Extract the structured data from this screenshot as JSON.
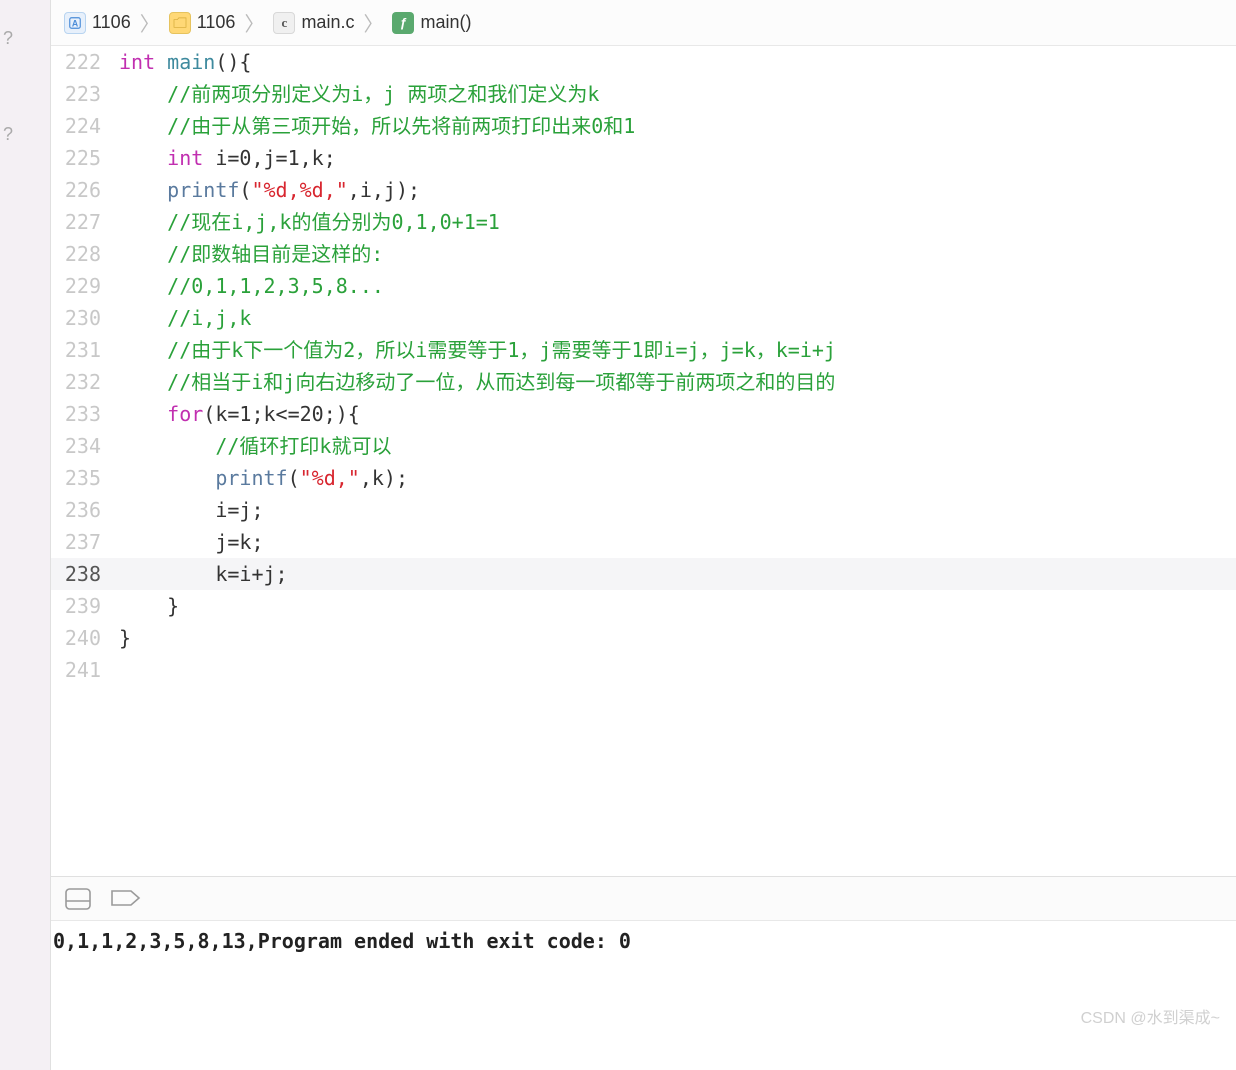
{
  "breadcrumb": [
    {
      "icon": "project",
      "label": "1106"
    },
    {
      "icon": "folder",
      "label": "1106"
    },
    {
      "icon": "cfile",
      "label": "main.c"
    },
    {
      "icon": "func",
      "label": "main()"
    }
  ],
  "current_line": 238,
  "lines": [
    {
      "n": 222,
      "tokens": [
        [
          "kw",
          "int "
        ],
        [
          "func",
          "main"
        ],
        [
          "plain",
          "(){"
        ]
      ]
    },
    {
      "n": 223,
      "tokens": [
        [
          "plain",
          "    "
        ],
        [
          "cmt",
          "//前两项分别定义为i，j 两项之和我们定义为k"
        ]
      ]
    },
    {
      "n": 224,
      "tokens": [
        [
          "plain",
          "    "
        ],
        [
          "cmt",
          "//由于从第三项开始，所以先将前两项打印出来0和1"
        ]
      ]
    },
    {
      "n": 225,
      "tokens": [
        [
          "plain",
          "    "
        ],
        [
          "kw",
          "int"
        ],
        [
          "plain",
          " i=0,j=1,k;"
        ]
      ]
    },
    {
      "n": 226,
      "tokens": [
        [
          "plain",
          "    "
        ],
        [
          "call",
          "printf"
        ],
        [
          "plain",
          "("
        ],
        [
          "str",
          "\"%d,%d,\""
        ],
        [
          "plain",
          ",i,j);"
        ]
      ]
    },
    {
      "n": 227,
      "tokens": [
        [
          "plain",
          "    "
        ],
        [
          "cmt",
          "//现在i,j,k的值分别为0,1,0+1=1"
        ]
      ]
    },
    {
      "n": 228,
      "tokens": [
        [
          "plain",
          "    "
        ],
        [
          "cmt",
          "//即数轴目前是这样的:"
        ]
      ]
    },
    {
      "n": 229,
      "tokens": [
        [
          "plain",
          "    "
        ],
        [
          "cmt",
          "//0,1,1,2,3,5,8..."
        ]
      ]
    },
    {
      "n": 230,
      "tokens": [
        [
          "plain",
          "    "
        ],
        [
          "cmt",
          "//i,j,k"
        ]
      ]
    },
    {
      "n": 231,
      "tokens": [
        [
          "plain",
          "    "
        ],
        [
          "cmt",
          "//由于k下一个值为2，所以i需要等于1，j需要等于1即i=j，j=k，k=i+j"
        ]
      ]
    },
    {
      "n": 232,
      "tokens": [
        [
          "plain",
          "    "
        ],
        [
          "cmt",
          "//相当于i和j向右边移动了一位，从而达到每一项都等于前两项之和的目的"
        ]
      ]
    },
    {
      "n": 233,
      "tokens": [
        [
          "plain",
          "    "
        ],
        [
          "kw",
          "for"
        ],
        [
          "plain",
          "(k=1;k<=20;){"
        ]
      ]
    },
    {
      "n": 234,
      "tokens": [
        [
          "plain",
          "        "
        ],
        [
          "cmt",
          "//循环打印k就可以"
        ]
      ]
    },
    {
      "n": 235,
      "tokens": [
        [
          "plain",
          "        "
        ],
        [
          "call",
          "printf"
        ],
        [
          "plain",
          "("
        ],
        [
          "str",
          "\"%d,\""
        ],
        [
          "plain",
          ",k);"
        ]
      ]
    },
    {
      "n": 236,
      "tokens": [
        [
          "plain",
          "        i=j;"
        ]
      ]
    },
    {
      "n": 237,
      "tokens": [
        [
          "plain",
          "        j=k;"
        ]
      ]
    },
    {
      "n": 238,
      "tokens": [
        [
          "plain",
          "        k=i+j;"
        ]
      ]
    },
    {
      "n": 239,
      "tokens": [
        [
          "plain",
          "    }"
        ]
      ]
    },
    {
      "n": 240,
      "tokens": [
        [
          "plain",
          "}"
        ]
      ]
    },
    {
      "n": 241,
      "tokens": [
        [
          "plain",
          ""
        ]
      ]
    }
  ],
  "console_output": "0,1,1,2,3,5,8,13,Program ended with exit code: 0",
  "watermark": "CSDN @水到渠成~",
  "question_marks": [
    "?",
    "?"
  ]
}
